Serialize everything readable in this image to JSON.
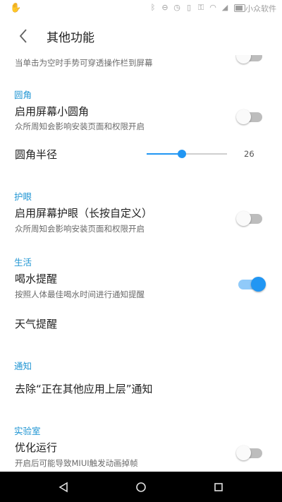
{
  "status_bar": {
    "watermark": "小众软件"
  },
  "toolbar": {
    "title": "其他功能"
  },
  "top_partial": {
    "summary": "当单击为空时手势可穿透操作栏到屏幕",
    "switch_on": false
  },
  "sections": {
    "rounded": {
      "header": "圆角",
      "enable_title": "启用屏幕小圆角",
      "enable_summary": "众所周知会影响安装页面和权限开启",
      "enable_on": false,
      "radius_title": "圆角半径",
      "radius_value": "26",
      "radius_fraction": 0.44
    },
    "eye": {
      "header": "护眼",
      "enable_title": "启用屏幕护眼（长按自定义）",
      "enable_summary": "众所周知会影响安装页面和权限开启",
      "enable_on": false
    },
    "life": {
      "header": "生活",
      "water_title": "喝水提醒",
      "water_summary": "按照人体最佳喝水时间进行通知提醒",
      "water_on": true,
      "weather_title": "天气提醒"
    },
    "notify": {
      "header": "通知",
      "remove_title": "去除“正在其他应用上层”通知"
    },
    "lab": {
      "header": "实验室",
      "optimize_title": "优化运行",
      "optimize_summary": "开启后可能导致MIUI触发动画掉帧",
      "optimize_on": false
    }
  },
  "colors": {
    "accent": "#2196f3",
    "category": "#2196d3",
    "navbar": "#000000"
  },
  "icons": {
    "back": "back-arrow-icon",
    "nav_back": "nav-back-icon",
    "nav_home": "nav-home-icon",
    "nav_recents": "nav-recents-icon"
  }
}
